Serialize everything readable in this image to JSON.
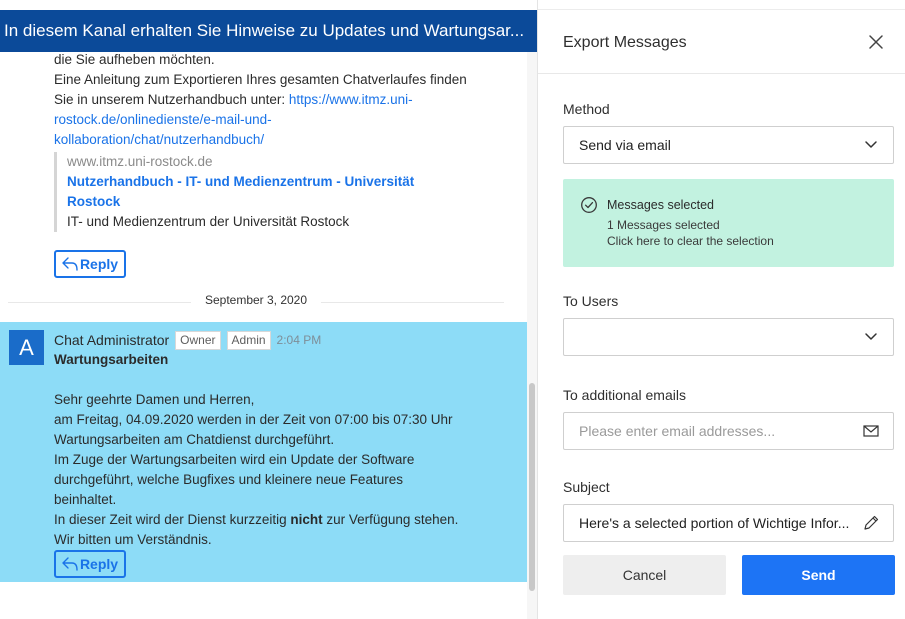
{
  "chat": {
    "channel_banner": "In diesem Kanal erhalten Sie Hinweise zu Updates und Wartungsar...",
    "previous_message": {
      "lines": [
        "die Sie aufheben möchten.",
        "Eine Anleitung zum Exportieren Ihres gesamten Chatverlaufes finden",
        "Sie in unserem Nutzerhandbuch unter: "
      ],
      "link_part1": "https://www.itmz.uni-",
      "link_part2": "rostock.de/onlinedienste/e-mail-und-",
      "link_part3": "kollaboration/chat/nutzerhandbuch/",
      "preview": {
        "host": "www.itmz.uni-rostock.de",
        "title": "Nutzerhandbuch - IT- und Medienzentrum - Universität Rostock",
        "description": "IT- und Medienzentrum der Universität Rostock"
      },
      "reply_label": "Reply"
    },
    "date_separator": "September 3, 2020",
    "selected_message": {
      "avatar_letter": "A",
      "author": "Chat Administrator",
      "badges": [
        "Owner",
        "Admin"
      ],
      "time": "2:04 PM",
      "subject": "Wartungsarbeiten",
      "lines": [
        "Sehr geehrte Damen und Herren,",
        "am Freitag, 04.09.2020 werden in der Zeit von 07:00 bis 07:30 Uhr",
        "Wartungsarbeiten am Chatdienst durchgeführt.",
        "Im Zuge der Wartungsarbeiten wird ein Update der Software",
        "durchgeführt, welche Bugfixes und kleinere neue Features",
        "beinhaltet."
      ],
      "line_bold_before": "In dieser Zeit wird der Dienst kurzzeitig ",
      "line_bold_word": "nicht",
      "line_bold_after": " zur Verfügung stehen.",
      "closing": "Wir bitten um Verständnis.",
      "reply_label": "Reply"
    }
  },
  "export_panel": {
    "title": "Export Messages",
    "method_label": "Method",
    "method_value": "Send via email",
    "selection": {
      "heading": "Messages selected",
      "count_text": "1 Messages selected",
      "clear_text": "Click here to clear the selection"
    },
    "to_users_label": "To Users",
    "to_users_value": "",
    "additional_emails_label": "To additional emails",
    "additional_emails_placeholder": "Please enter email addresses...",
    "subject_label": "Subject",
    "subject_value": "Here's a selected portion of Wichtige Infor...",
    "cancel_label": "Cancel",
    "send_label": "Send"
  },
  "colors": {
    "banner": "#0b4a99",
    "selected_message_bg": "#8ddcf7",
    "selection_box_bg": "#c2f2e0",
    "send_button": "#1d74f5",
    "link": "#1a73e8"
  },
  "icons": [
    "reply-icon",
    "close-icon",
    "chevron-down-icon",
    "check-circle-icon",
    "envelope-icon",
    "pencil-icon"
  ]
}
